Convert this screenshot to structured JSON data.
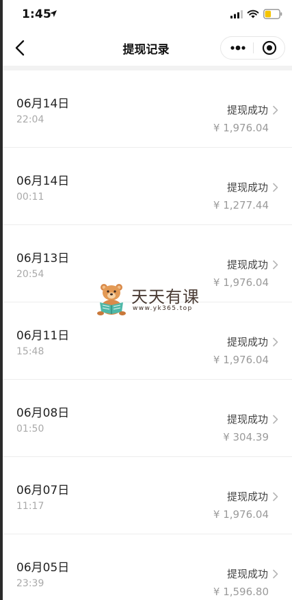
{
  "status_bar": {
    "time": "1:45"
  },
  "nav": {
    "title": "提现记录"
  },
  "records": [
    {
      "date": "06月14日",
      "time": "22:04",
      "status": "提现成功",
      "amount": "¥ 1,976.04"
    },
    {
      "date": "06月14日",
      "time": "00:11",
      "status": "提现成功",
      "amount": "¥ 1,277.44"
    },
    {
      "date": "06月13日",
      "time": "20:54",
      "status": "提现成功",
      "amount": "¥ 1,976.04"
    },
    {
      "date": "06月11日",
      "time": "15:48",
      "status": "提现成功",
      "amount": "¥ 1,976.04"
    },
    {
      "date": "06月08日",
      "time": "01:50",
      "status": "提现成功",
      "amount": "¥ 304.39"
    },
    {
      "date": "06月07日",
      "time": "11:17",
      "status": "提现成功",
      "amount": "¥ 1,976.04"
    },
    {
      "date": "06月05日",
      "time": "23:39",
      "status": "提现成功",
      "amount": "¥ 1,596.80"
    }
  ],
  "watermark": {
    "brand": "天天有课",
    "url": "www.yk365.top"
  },
  "colors": {
    "text_primary": "#222222",
    "text_secondary": "#a9a9a9",
    "amount": "#9a9a9a",
    "divider": "#ededed"
  }
}
